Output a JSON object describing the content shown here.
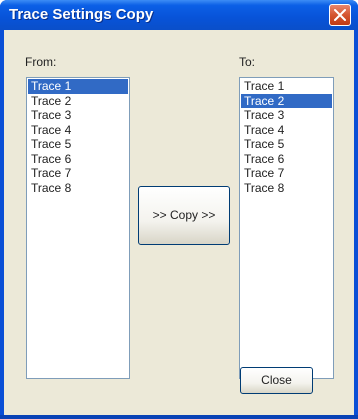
{
  "window": {
    "title": "Trace Settings Copy"
  },
  "from": {
    "label": "From:",
    "items": [
      "Trace 1",
      "Trace 2",
      "Trace 3",
      "Trace 4",
      "Trace 5",
      "Trace 6",
      "Trace 7",
      "Trace 8"
    ],
    "selected": "Trace 1"
  },
  "to": {
    "label": "To:",
    "items": [
      "Trace 1",
      "Trace 2",
      "Trace 3",
      "Trace 4",
      "Trace 5",
      "Trace 6",
      "Trace 7",
      "Trace 8"
    ],
    "selected": "Trace 2"
  },
  "buttons": {
    "copy": ">> Copy >>",
    "close": "Close"
  },
  "icons": {
    "title_close": "close-icon"
  },
  "colors": {
    "titlebar": "#0a58e0",
    "selection": "#316ac5",
    "dialog_bg": "#ece9d8",
    "close_button": "#d4552f"
  }
}
